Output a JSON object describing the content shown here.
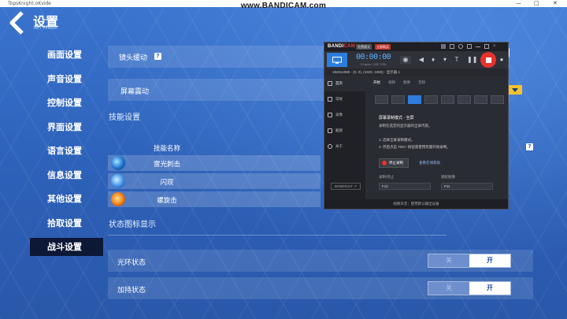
{
  "window": {
    "app_title": "TopsKnight.oKvide",
    "watermark": "www.BANDICAM.com",
    "minimize": "—",
    "maximize": "□",
    "close": "✕"
  },
  "header": {
    "title": "设置",
    "subtitle": "SETTINGS"
  },
  "sidebar": {
    "items": [
      {
        "label": "画面设置"
      },
      {
        "label": "声音设置"
      },
      {
        "label": "控制设置"
      },
      {
        "label": "界面设置"
      },
      {
        "label": "语言设置"
      },
      {
        "label": "信息设置"
      },
      {
        "label": "其他设置"
      },
      {
        "label": "拾取设置"
      },
      {
        "label": "战斗设置",
        "active": true
      }
    ]
  },
  "main": {
    "camera_shake_label": "镜头缓动",
    "camera_shake_help": "?",
    "screen_shake_label": "屏幕震动",
    "skill_section_title": "技能设置",
    "skill_help": "?",
    "skill_column_header": "技能名称",
    "skills": [
      {
        "name": "雷光刺击",
        "icon": "lightning-skill-icon"
      },
      {
        "name": "闪现",
        "icon": "blink-skill-icon"
      },
      {
        "name": "螺旋击",
        "icon": "spiral-skill-icon"
      }
    ],
    "status_section_title": "状态图标显示",
    "status_rows": [
      {
        "label": "光环状态",
        "off": "关",
        "on": "开"
      },
      {
        "label": "加持状态",
        "off": "关",
        "on": "开"
      }
    ]
  },
  "bandicam": {
    "logo_main": "BANDI",
    "logo_accent": "CAM",
    "tag_free": "免费模式",
    "tag_upgrade": "立即购买",
    "timer": "00:00:00",
    "file_size": "0 bytes / 182.7GB",
    "status_text": "1920x1080 - (0, 0), (1920, 1080) - 显示器 1",
    "nav": [
      {
        "label": "首页",
        "active": true
      },
      {
        "label": "常规"
      },
      {
        "label": "录像"
      },
      {
        "label": "截图"
      },
      {
        "label": "关于"
      }
    ],
    "tabs": [
      "开始",
      "视频",
      "图像",
      "音频"
    ],
    "mode_title": "屏幕录制模式 - 全屏",
    "mode_desc": "录制在选定的显示器的全屏内容。",
    "step1": "1. 选择全屏录制模式。",
    "step2": "2. 然后点击 'REC' 按钮或使用热键开始录制。",
    "stop_button": "停止录制",
    "help_link": "查看在线帮助",
    "hotkey_record_label": "录制/停止",
    "hotkey_record_value": "F12",
    "hotkey_capture_label": "捕捉图像",
    "hotkey_capture_value": "F11",
    "bandicut": "BANDICUT ↗",
    "footer": "视频声音：使用默认输出设备"
  },
  "colors": {
    "background": "#2f62b7",
    "active_nav": "#0c1836",
    "rec_red": "#e7332b",
    "bandicam_blue": "#2d7ddc",
    "dropdown_yellow": "#f2c233"
  }
}
